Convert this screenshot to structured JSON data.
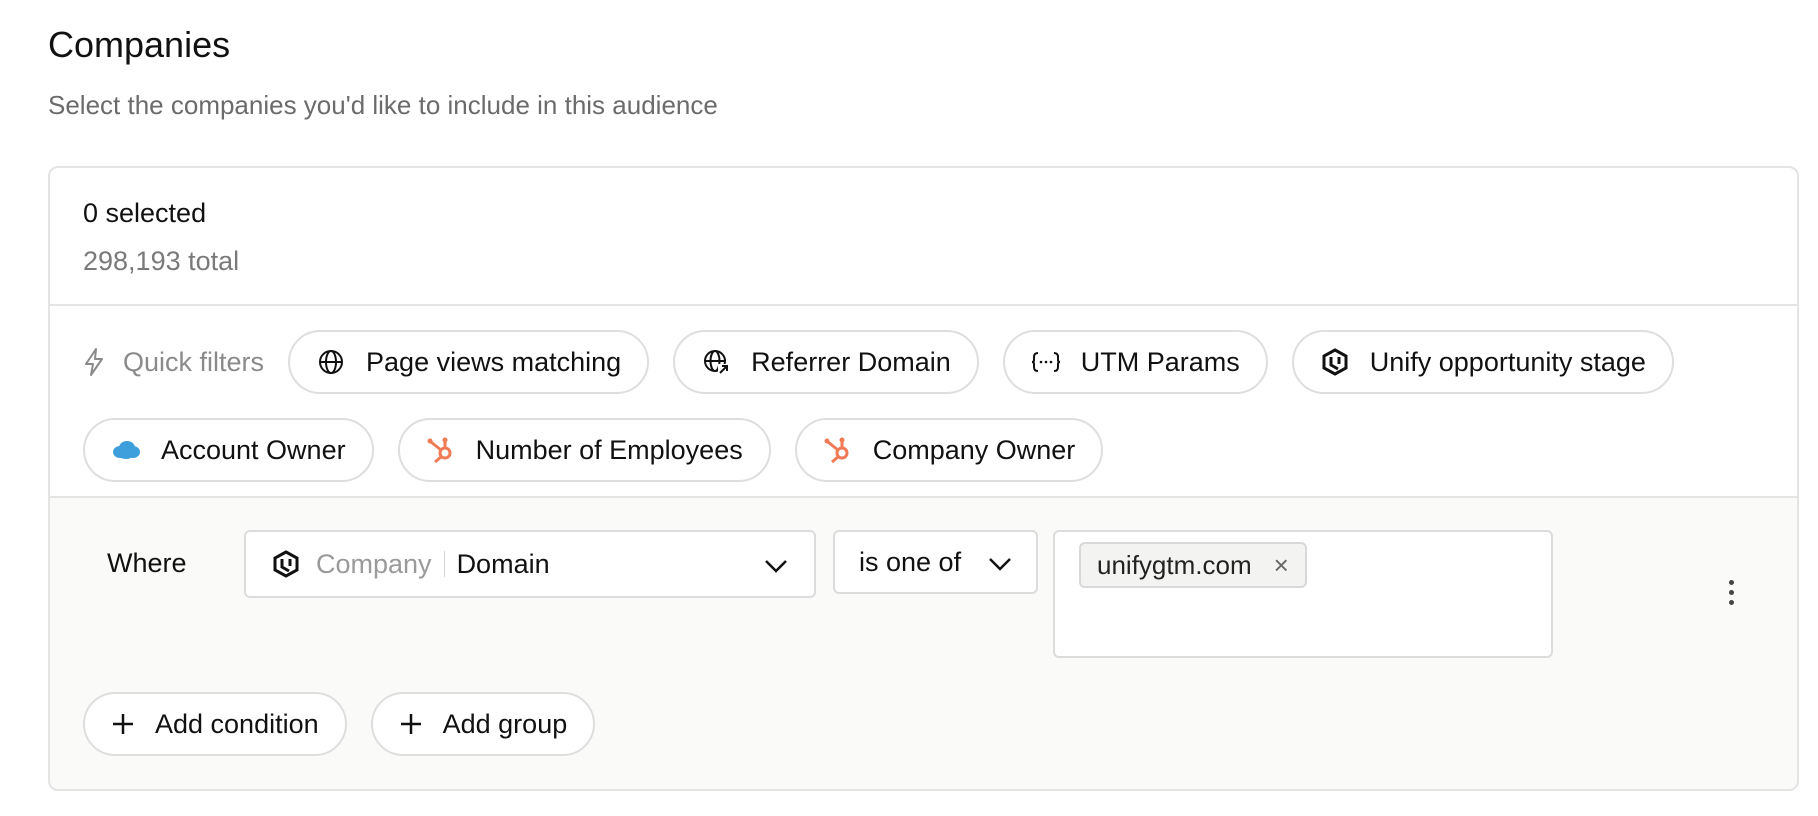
{
  "header": {
    "title": "Companies",
    "subtitle": "Select the companies you'd like to include in this audience"
  },
  "summary": {
    "selected": "0 selected",
    "total": "298,193 total"
  },
  "quick_filters": {
    "label": "Quick filters",
    "chips": [
      {
        "label": "Page views matching",
        "icon": "globe-icon"
      },
      {
        "label": "Referrer Domain",
        "icon": "globe-arrow-icon"
      },
      {
        "label": "UTM Params",
        "icon": "braces-icon"
      },
      {
        "label": "Unify opportunity stage",
        "icon": "unify-logo-icon"
      },
      {
        "label": "Account Owner",
        "icon": "salesforce-cloud-icon"
      },
      {
        "label": "Number of Employees",
        "icon": "hubspot-icon"
      },
      {
        "label": "Company Owner",
        "icon": "hubspot-icon"
      }
    ]
  },
  "condition": {
    "where_label": "Where",
    "field_category": "Company",
    "field_name": "Domain",
    "operator": "is one of",
    "values": [
      "unifygtm.com"
    ],
    "remove_glyph": "×"
  },
  "actions": {
    "add_condition": "Add condition",
    "add_group": "Add group"
  },
  "colors": {
    "hubspot": "#f07a55",
    "salesforce": "#3f9fdc",
    "border": "#e4e4e4",
    "muted_text": "#7a7a7a"
  }
}
